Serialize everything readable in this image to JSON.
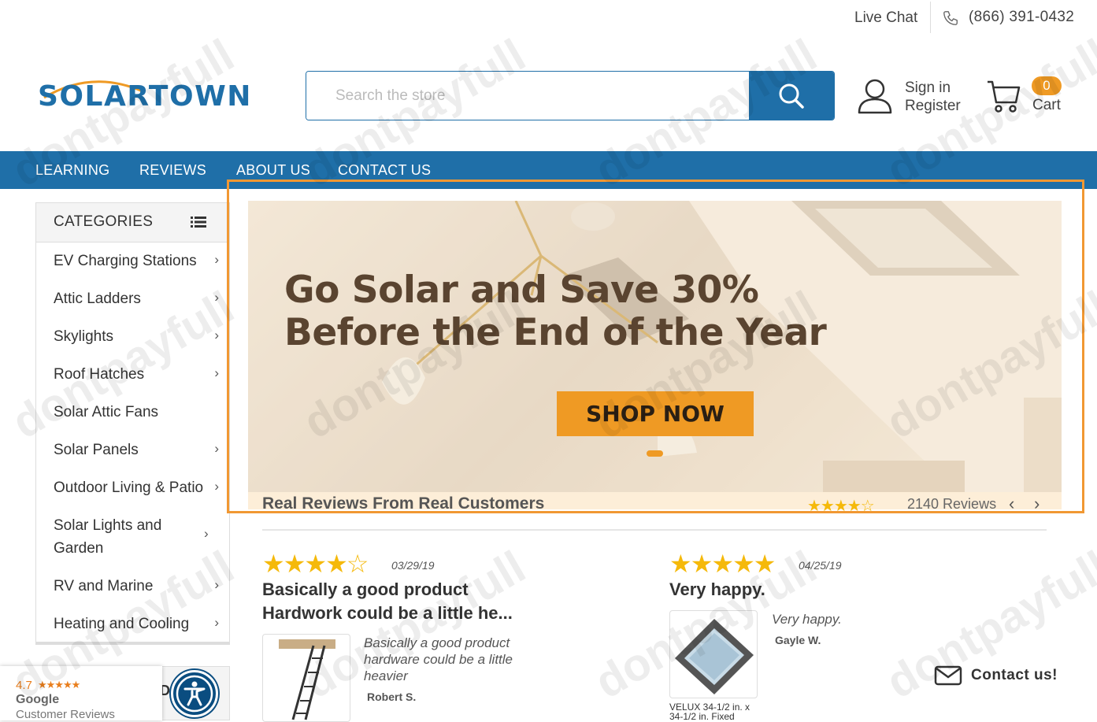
{
  "topbar": {
    "live_chat": "Live Chat",
    "phone": "(866) 391-0432"
  },
  "header": {
    "logo_text": "SOLARTOWN",
    "search_placeholder": "Search the store",
    "sign_in": "Sign in",
    "register": "Register",
    "cart_count": "0",
    "cart_label": "Cart"
  },
  "nav": {
    "items": [
      "LEARNING",
      "REVIEWS",
      "ABOUT US",
      "CONTACT US"
    ]
  },
  "sidebar": {
    "title": "CATEGORIES",
    "items": [
      {
        "label": "EV Charging Stations",
        "has_sub": true
      },
      {
        "label": "Attic Ladders",
        "has_sub": true
      },
      {
        "label": "Skylights",
        "has_sub": true
      },
      {
        "label": "Roof Hatches",
        "has_sub": true
      },
      {
        "label": "Solar Attic Fans",
        "has_sub": false
      },
      {
        "label": "Solar Panels",
        "has_sub": true
      },
      {
        "label": "Outdoor Living & Patio",
        "has_sub": true
      },
      {
        "label": "Solar Lights and Garden",
        "has_sub": true
      },
      {
        "label": "RV and Marine",
        "has_sub": true
      },
      {
        "label": "Heating and Cooling",
        "has_sub": true
      }
    ],
    "chevron": "›"
  },
  "hero": {
    "line1": "Go Solar and Save 30%",
    "line2": "Before the End of the Year",
    "cta": "SHOP NOW"
  },
  "reviews_bar": {
    "heading": "Real Reviews From Real Customers",
    "stars": "★★★★☆",
    "rating": 4.5,
    "count": "2140 Reviews",
    "prev": "‹",
    "next": "›"
  },
  "reviews": [
    {
      "stars": "★★★★☆",
      "rating": 4,
      "date": "03/29/19",
      "title_line1": "Basically a good product",
      "title_line2": "Hardwork could be a little he...",
      "body_line1": "Basically a good product",
      "body_line2": "hardware could be a little",
      "body_line3": "heavier",
      "author": "Robert S."
    },
    {
      "stars": "★★★★★",
      "rating": 5,
      "date": "04/25/19",
      "title_line1": "Very happy.",
      "body_line1": "Very happy.",
      "author": "Gayle W.",
      "caption_line1": "VELUX 34-1/2 in. x",
      "caption_line2": "34-1/2 in. Fixed"
    }
  ],
  "google_badge": {
    "score": "4.7",
    "stars": "★★★★★",
    "name": "Google",
    "sub": "Customer Reviews"
  },
  "sidebar2_text": "DS",
  "contact_us": "Contact us!",
  "watermark": "dontpayfull",
  "colors": {
    "brand_blue": "#1f6fa8",
    "accent_orange": "#ef9a24",
    "star_yellow": "#f5b90a",
    "highlight_orange": "#f19833"
  }
}
